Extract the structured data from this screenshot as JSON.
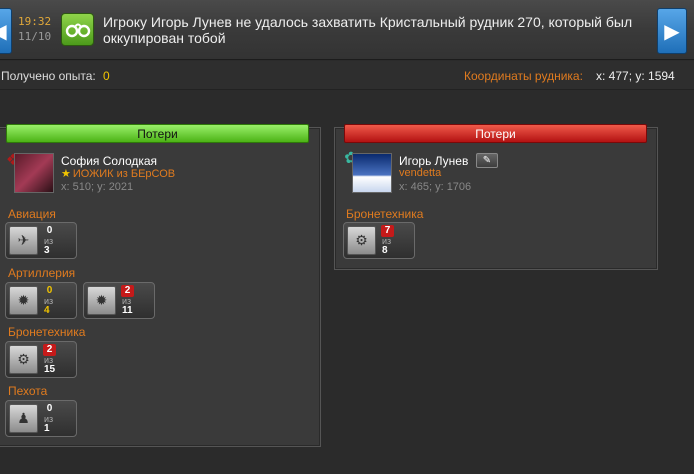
{
  "message": {
    "time": "19:32",
    "date": "11/10",
    "text": "Игроку Игорь Лунев не удалось захватить Кристальный рудник 270, который был оккупирован тобой"
  },
  "info": {
    "exp_label": "Получено опыта:",
    "exp_value": "0",
    "coords_label": "Координаты рудника:",
    "coords_value": "x: 477; y: 1594"
  },
  "left": {
    "header": "Потери",
    "player": {
      "name": "София Солодкая",
      "alliance": "ИОЖИК из БЕрСОВ",
      "coords": "x: 510; y: 2021"
    },
    "categories": [
      {
        "label": "Авиация",
        "units": [
          {
            "lost": "0",
            "of": "из",
            "total": "3"
          }
        ]
      },
      {
        "label": "Артиллерия",
        "units": [
          {
            "lost": "0",
            "of": "из",
            "total": "4"
          },
          {
            "lost": "2",
            "of": "из",
            "total": "11"
          }
        ]
      },
      {
        "label": "Бронетехника",
        "units": [
          {
            "lost": "2",
            "of": "из",
            "total": "15"
          }
        ]
      },
      {
        "label": "Пехота",
        "units": [
          {
            "lost": "0",
            "of": "из",
            "total": "1"
          }
        ]
      }
    ]
  },
  "right": {
    "header": "Потери",
    "player": {
      "name": "Игорь Лунев",
      "alliance": "vendetta",
      "coords": "x: 465; y: 1706"
    },
    "categories": [
      {
        "label": "Бронетехника",
        "units": [
          {
            "lost": "7",
            "of": "из",
            "total": "8"
          }
        ]
      }
    ]
  },
  "colors": {
    "accent_orange": "#e07b1f",
    "header_green": "#4cb316",
    "header_red": "#b31212",
    "badge_red": "#c51a1a",
    "value_yellow": "#f2c500"
  },
  "icons": {
    "message": "handcuffs-icon",
    "nav_left": "chevron-left-icon",
    "nav_right": "chevron-right-icon",
    "edit": "pencil-icon",
    "star": "star-icon"
  }
}
